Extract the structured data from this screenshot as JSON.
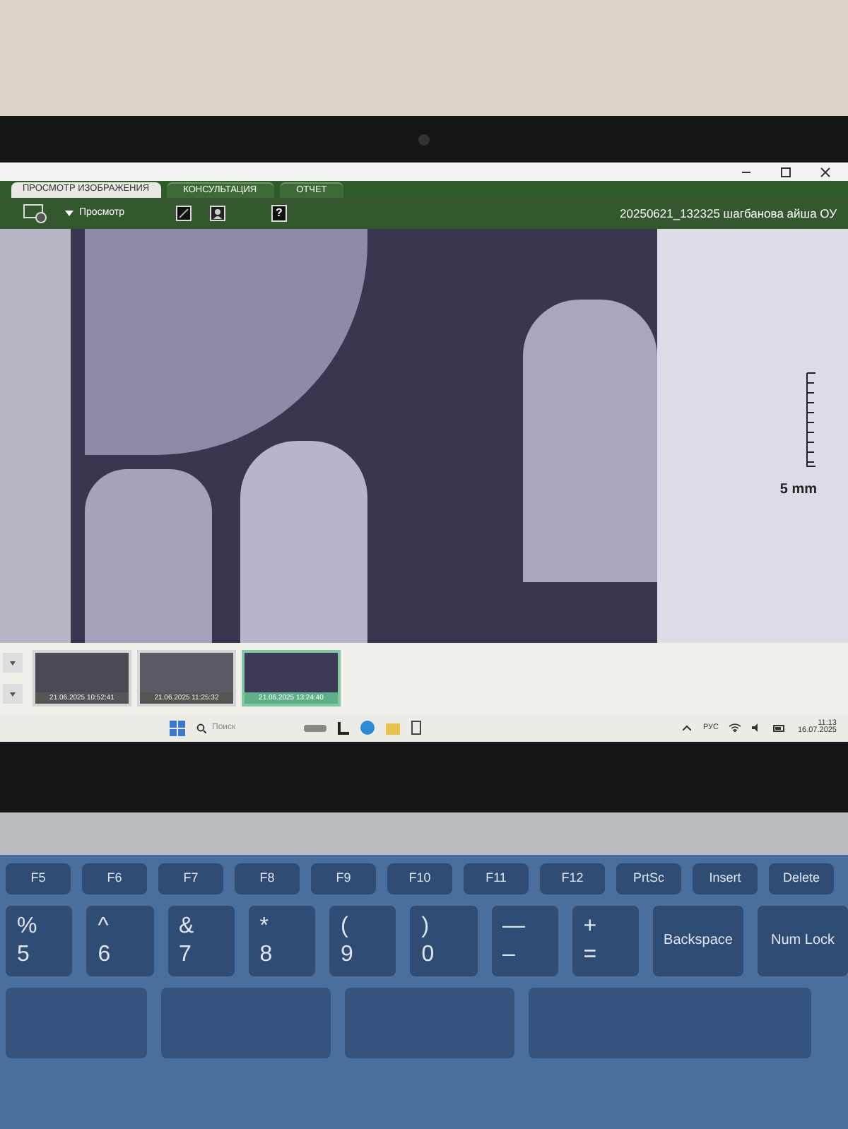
{
  "tabs": [
    {
      "label": "ПРОСМОТР ИЗОБРАЖЕНИЯ",
      "selected": true
    },
    {
      "label": "КОНСУЛЬТАЦИЯ",
      "selected": false
    },
    {
      "label": "ОТЧЕТ",
      "selected": false
    }
  ],
  "toolbar": {
    "view_label": "Просмотр",
    "help_label": "?",
    "patient_title": "20250621_132325 шагбанова айша ОУ"
  },
  "viewer": {
    "scale_label": "5 mm"
  },
  "thumbnails": [
    {
      "caption": "21.06.2025 10:52:41",
      "selected": false
    },
    {
      "caption": "21.06.2025 11:25:32",
      "selected": false
    },
    {
      "caption": "21.06.2025 13:24:40",
      "selected": true
    }
  ],
  "taskbar": {
    "search_placeholder": "Поиск",
    "language": "РУС",
    "time": "11:13",
    "date": "16.07.2025"
  },
  "keyboard": {
    "function_keys": [
      "F5",
      "F6",
      "F7",
      "F8",
      "F9",
      "F10",
      "F11",
      "F12",
      "PrtSc",
      "Insert",
      "Delete"
    ],
    "number_keys": [
      {
        "top": "%",
        "main": "5"
      },
      {
        "top": "^",
        "main": "6"
      },
      {
        "top": "&",
        "main": "7"
      },
      {
        "top": "*",
        "main": "8"
      },
      {
        "top": "(",
        "main": "9"
      },
      {
        "top": ")",
        "main": "0"
      },
      {
        "top": "—",
        "main": "–"
      },
      {
        "top": "+",
        "main": "="
      },
      {
        "main": "Backspace"
      },
      {
        "main": "Num Lock"
      }
    ]
  }
}
